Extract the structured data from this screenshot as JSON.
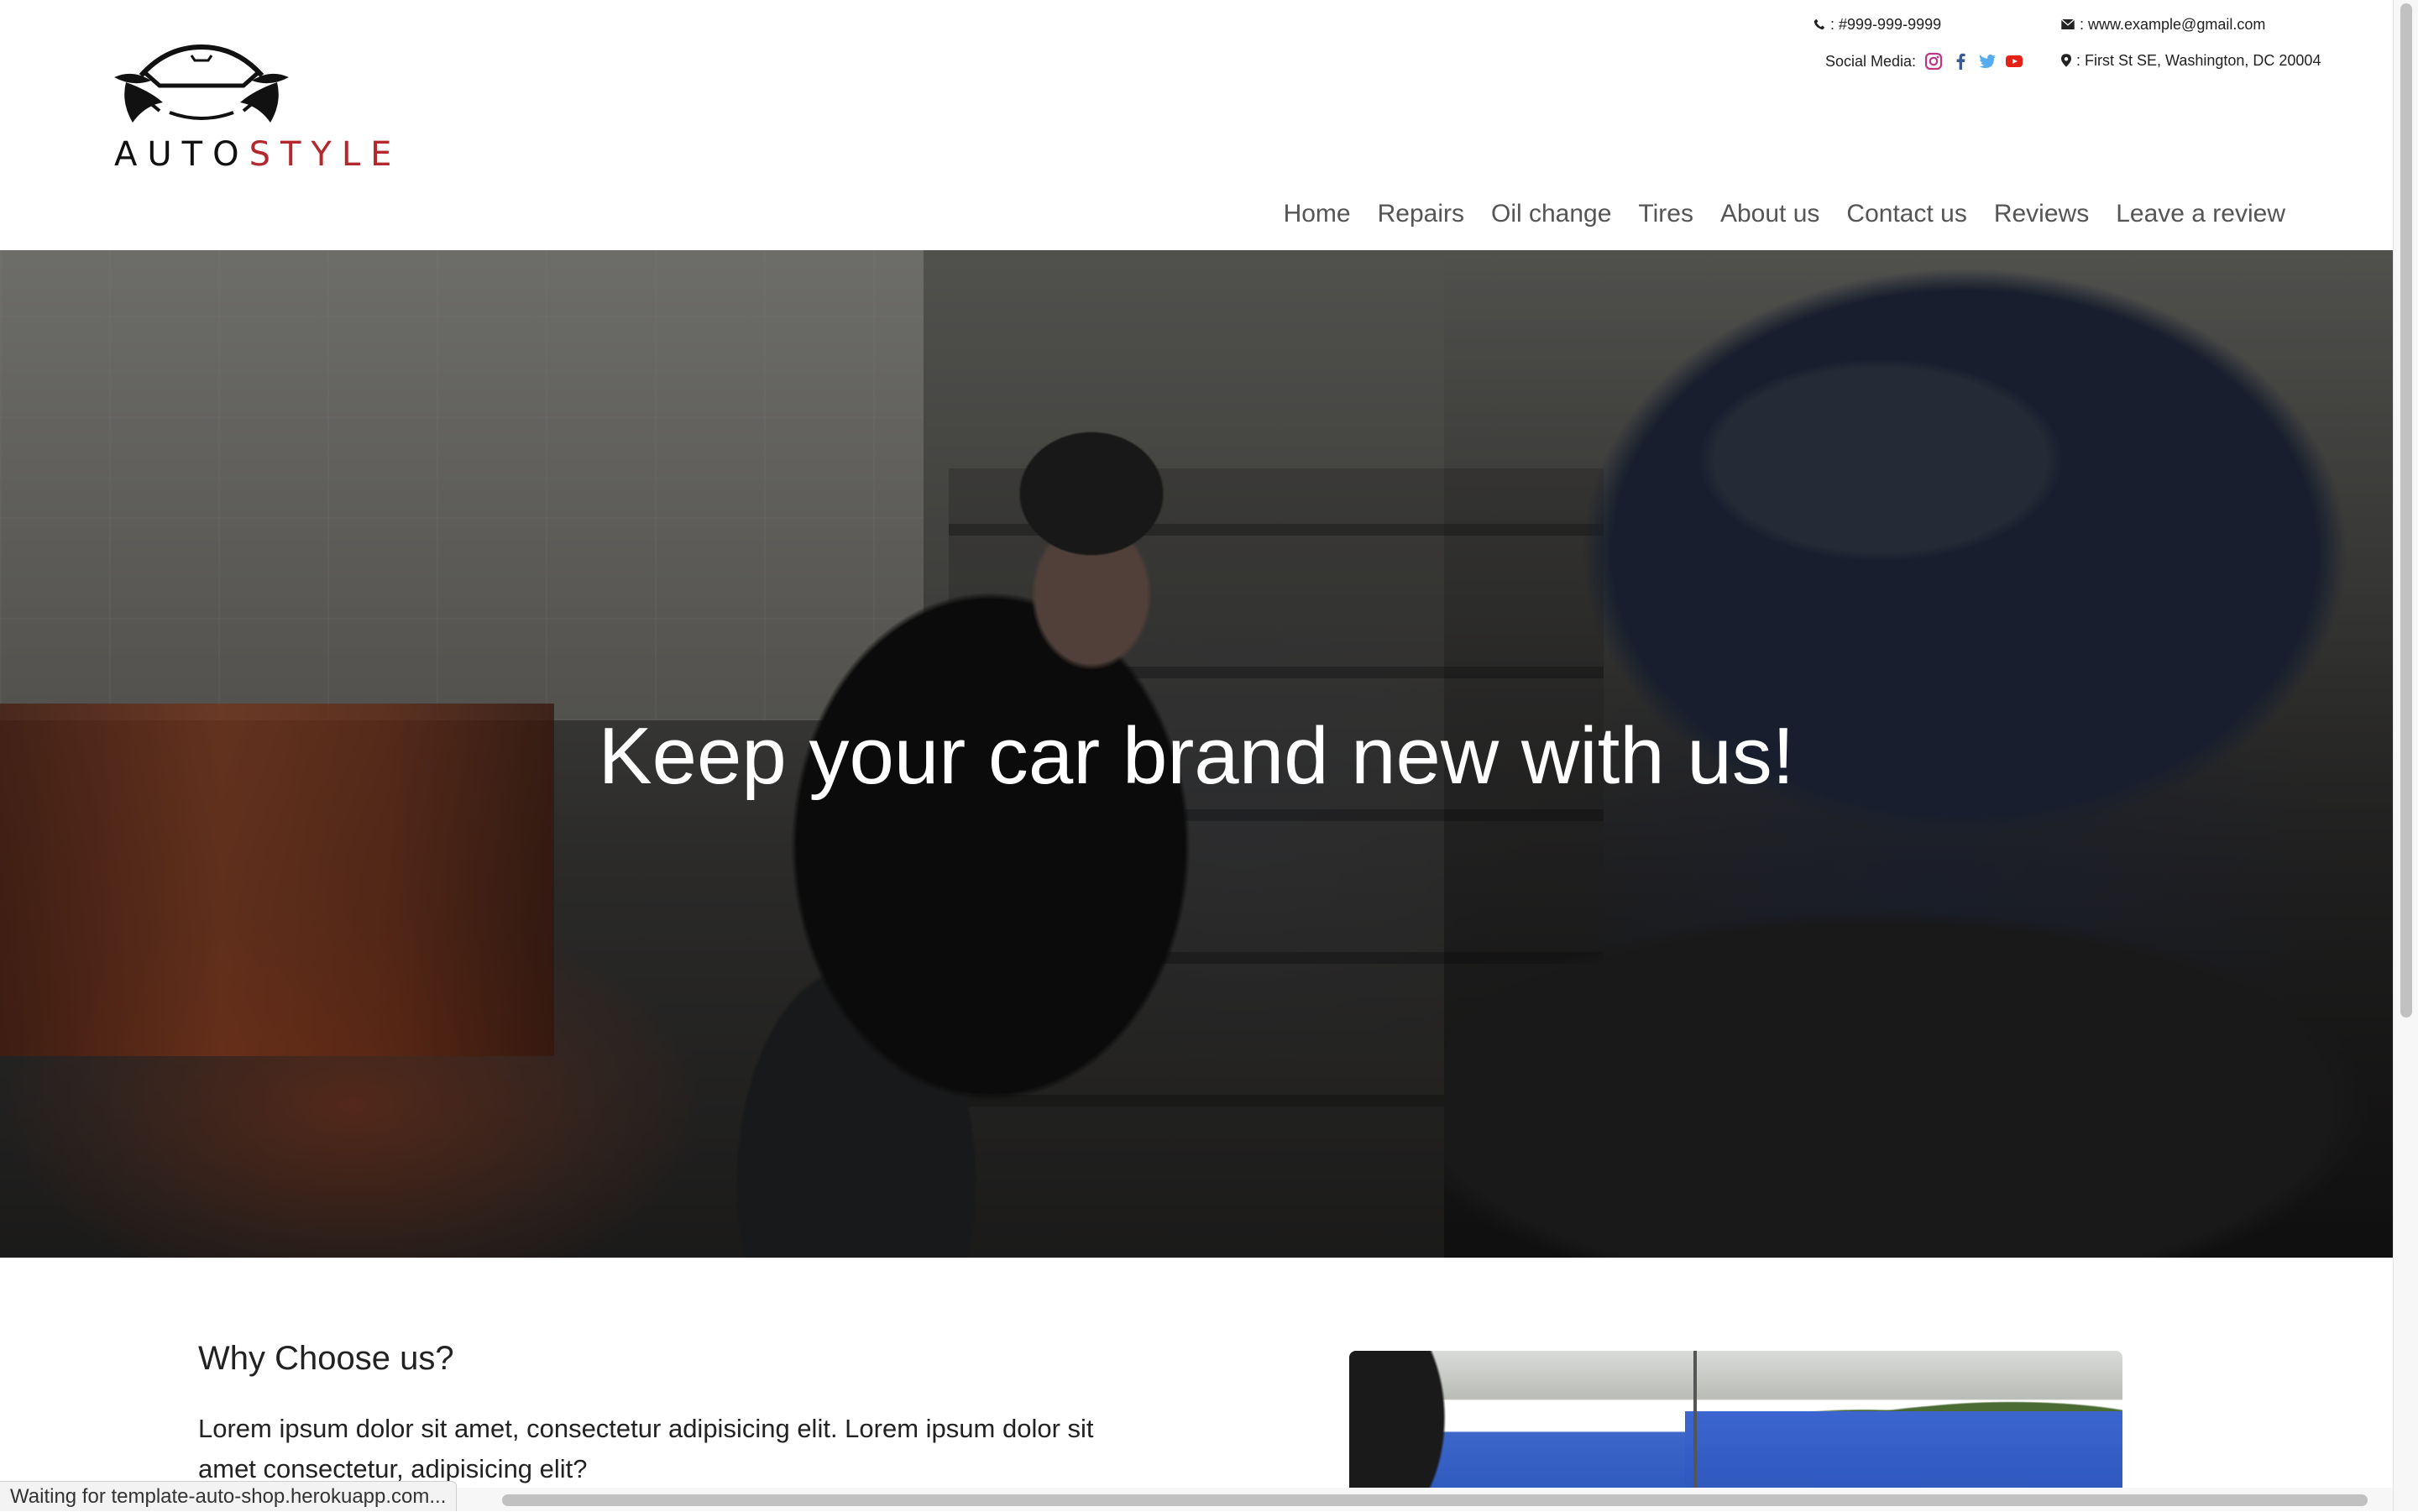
{
  "brand": {
    "logo_part1": "AUTO",
    "logo_part2": "STYLE",
    "accent_color": "#b3282d"
  },
  "contact": {
    "phone": ": #999-999-9999",
    "email": ": www.example@gmail.com",
    "social_label": "Social Media:",
    "address": ": First St SE, Washington, DC 20004",
    "social_icons": [
      "instagram-icon",
      "facebook-icon",
      "twitter-icon",
      "youtube-icon"
    ]
  },
  "nav": {
    "items": [
      {
        "label": "Home"
      },
      {
        "label": "Repairs"
      },
      {
        "label": "Oil change"
      },
      {
        "label": "Tires"
      },
      {
        "label": "About us"
      },
      {
        "label": "Contact us"
      },
      {
        "label": "Reviews"
      },
      {
        "label": "Leave a review"
      }
    ]
  },
  "hero": {
    "title": "Keep your car brand new with us!"
  },
  "why": {
    "title": "Why Choose us?",
    "text": "Lorem ipsum dolor sit amet, consectetur adipisicing elit. Lorem ipsum dolor sit amet consectetur, adipisicing elit?"
  },
  "browser": {
    "status": "Waiting for template-auto-shop.herokuapp.com..."
  }
}
